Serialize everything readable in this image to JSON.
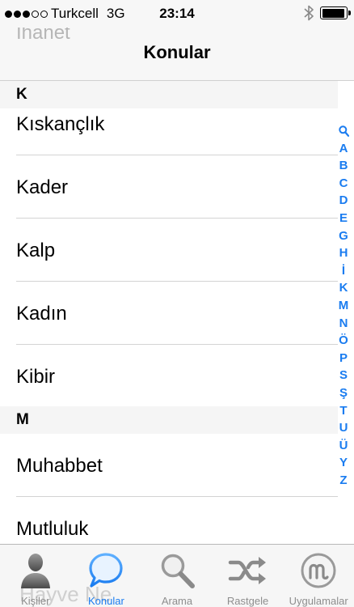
{
  "status": {
    "carrier": "Turkcell",
    "network": "3G",
    "time": "23:14",
    "battery_level": 0.95,
    "icons": [
      "signal-dots",
      "bluetooth-icon",
      "battery-icon"
    ]
  },
  "nav": {
    "title": "Konular",
    "ghost_text": "İhanet"
  },
  "sections": [
    {
      "header": "K",
      "items": [
        "Kıskançlık",
        "Kader",
        "Kalp",
        "Kadın",
        "Kibir"
      ]
    },
    {
      "header": "M",
      "items": [
        "Muhabbet",
        "Mutluluk"
      ]
    }
  ],
  "index": [
    "A",
    "B",
    "C",
    "D",
    "E",
    "G",
    "H",
    "İ",
    "K",
    "M",
    "N",
    "Ö",
    "P",
    "S",
    "Ş",
    "T",
    "U",
    "Ü",
    "Y",
    "Z"
  ],
  "tabs": {
    "ghost_text": "Hayve Ne",
    "items": [
      {
        "label": "Kişiler",
        "icon": "person-icon",
        "active": false
      },
      {
        "label": "Konular",
        "icon": "speech-bubble-icon",
        "active": true
      },
      {
        "label": "Arama",
        "icon": "magnifier-icon",
        "active": false
      },
      {
        "label": "Rastgele",
        "icon": "shuffle-icon",
        "active": false
      },
      {
        "label": "Uygulamalar",
        "icon": "apps-m-icon",
        "active": false
      }
    ]
  },
  "colors": {
    "accent": "#1a7cf0",
    "inactive": "#8e8e8e",
    "section_bg": "#f5f5f5"
  }
}
